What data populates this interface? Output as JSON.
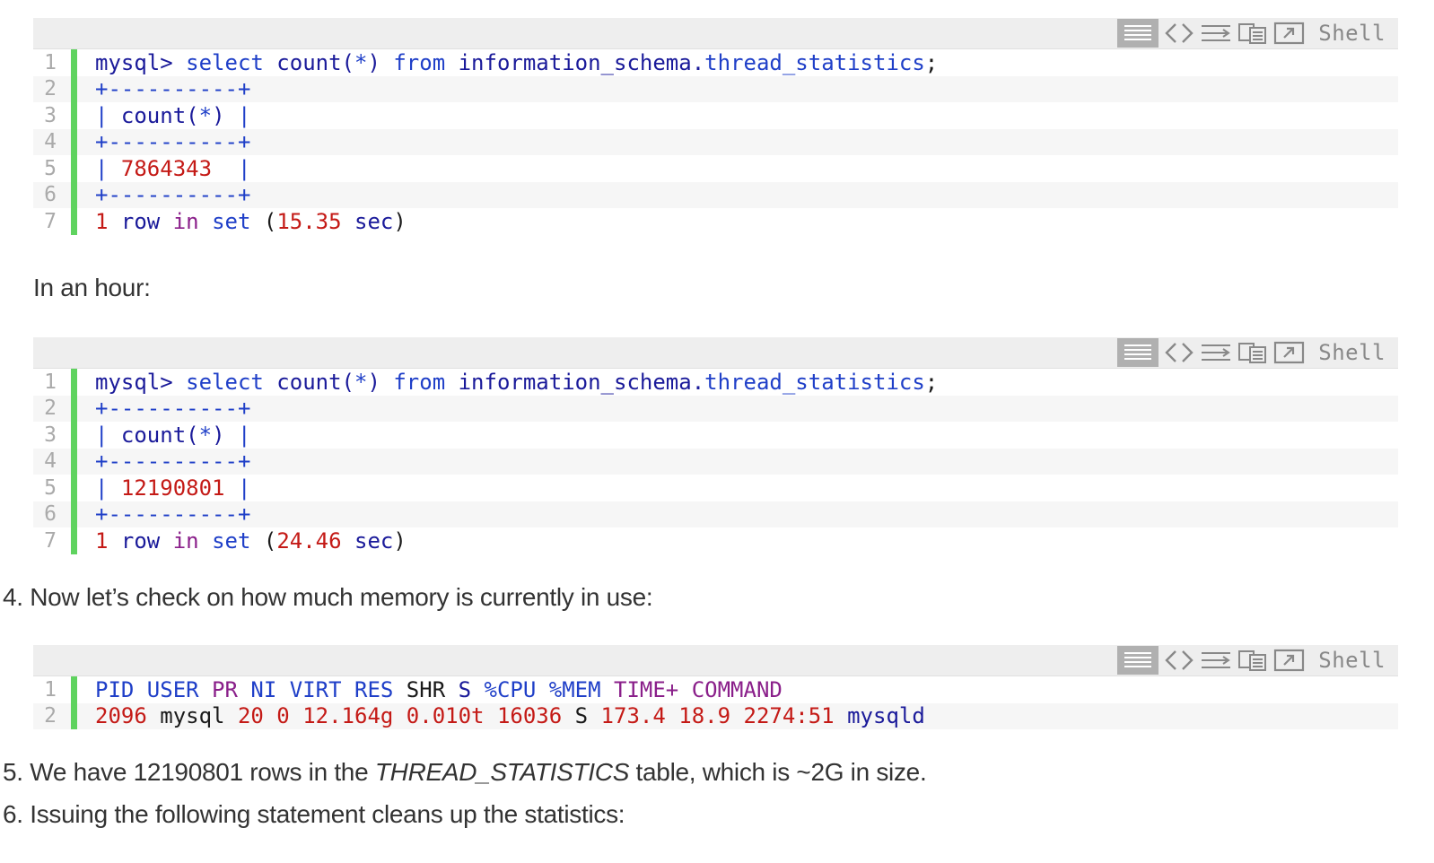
{
  "toolbar": {
    "lang_label": "Shell",
    "icons": [
      "view-lines-icon",
      "code-brackets-icon",
      "wrap-lines-icon",
      "copy-icon",
      "popout-icon"
    ]
  },
  "block1": {
    "lines": [
      {
        "n": "1",
        "tokens": [
          [
            "mysql>",
            "c-n"
          ],
          [
            " select ",
            "c-b"
          ],
          [
            "count(",
            "c-n"
          ],
          [
            "*",
            "c-b"
          ],
          [
            ") ",
            "c-n"
          ],
          [
            "from ",
            "c-b"
          ],
          [
            "information_schema.",
            "c-n"
          ],
          [
            "thread_statistics",
            "c-b"
          ],
          [
            ";",
            "c-k"
          ]
        ]
      },
      {
        "n": "2",
        "tokens": [
          [
            "+----------+",
            "c-b"
          ]
        ]
      },
      {
        "n": "3",
        "tokens": [
          [
            "| ",
            "c-b"
          ],
          [
            "count(",
            "c-n"
          ],
          [
            "*",
            "c-b"
          ],
          [
            ") ",
            "c-n"
          ],
          [
            "|",
            "c-b"
          ]
        ]
      },
      {
        "n": "4",
        "tokens": [
          [
            "+----------+",
            "c-b"
          ]
        ]
      },
      {
        "n": "5",
        "tokens": [
          [
            "| ",
            "c-b"
          ],
          [
            "7864343",
            "c-r"
          ],
          [
            "  |",
            "c-b"
          ]
        ]
      },
      {
        "n": "6",
        "tokens": [
          [
            "+----------+",
            "c-b"
          ]
        ]
      },
      {
        "n": "7",
        "tokens": [
          [
            "1",
            "c-r"
          ],
          [
            " row ",
            "c-n"
          ],
          [
            "in ",
            "c-p"
          ],
          [
            "set",
            "c-b"
          ],
          [
            " (",
            "c-k"
          ],
          [
            "15.35",
            "c-r"
          ],
          [
            " sec",
            "c-n"
          ],
          [
            ")",
            "c-k"
          ]
        ]
      }
    ]
  },
  "para_hour": "In an hour:",
  "block2": {
    "lines": [
      {
        "n": "1",
        "tokens": [
          [
            "mysql>",
            "c-n"
          ],
          [
            " select ",
            "c-b"
          ],
          [
            "count(",
            "c-n"
          ],
          [
            "*",
            "c-b"
          ],
          [
            ") ",
            "c-n"
          ],
          [
            "from ",
            "c-b"
          ],
          [
            "information_schema.",
            "c-n"
          ],
          [
            "thread_statistics",
            "c-b"
          ],
          [
            ";",
            "c-k"
          ]
        ]
      },
      {
        "n": "2",
        "tokens": [
          [
            "+----------+",
            "c-b"
          ]
        ]
      },
      {
        "n": "3",
        "tokens": [
          [
            "| ",
            "c-b"
          ],
          [
            "count(",
            "c-n"
          ],
          [
            "*",
            "c-b"
          ],
          [
            ") ",
            "c-n"
          ],
          [
            "|",
            "c-b"
          ]
        ]
      },
      {
        "n": "4",
        "tokens": [
          [
            "+----------+",
            "c-b"
          ]
        ]
      },
      {
        "n": "5",
        "tokens": [
          [
            "| ",
            "c-b"
          ],
          [
            "12190801",
            "c-r"
          ],
          [
            " |",
            "c-b"
          ]
        ]
      },
      {
        "n": "6",
        "tokens": [
          [
            "+----------+",
            "c-b"
          ]
        ]
      },
      {
        "n": "7",
        "tokens": [
          [
            "1",
            "c-r"
          ],
          [
            " row ",
            "c-n"
          ],
          [
            "in ",
            "c-p"
          ],
          [
            "set",
            "c-b"
          ],
          [
            " (",
            "c-k"
          ],
          [
            "24.46",
            "c-r"
          ],
          [
            " sec",
            "c-n"
          ],
          [
            ")",
            "c-k"
          ]
        ]
      }
    ]
  },
  "step4": "4. Now let’s check on how much memory is currently in use:",
  "block3": {
    "lines": [
      {
        "n": "1",
        "tokens": [
          [
            "PID USER ",
            "c-b"
          ],
          [
            "PR ",
            "c-p"
          ],
          [
            "NI VIRT RES ",
            "c-b"
          ],
          [
            "SHR ",
            "c-k"
          ],
          [
            "S ",
            "c-n"
          ],
          [
            "%CPU %MEM ",
            "c-b"
          ],
          [
            "TIME+ COMMAND",
            "c-p"
          ]
        ]
      },
      {
        "n": "2",
        "tokens": [
          [
            "2096",
            "c-r"
          ],
          [
            " mysql ",
            "c-k"
          ],
          [
            "20 0 12.164g 0.010t 16036",
            "c-r"
          ],
          [
            " S ",
            "c-k"
          ],
          [
            "173.4 18.9 2274:51",
            "c-r"
          ],
          [
            " mysqld",
            "c-n"
          ]
        ]
      }
    ]
  },
  "step5": {
    "pre": "5. We have 12190801 rows in the ",
    "em": "THREAD_STATISTICS",
    "post": " table, which is ~2G in size."
  },
  "step6": "6. Issuing the following statement cleans up the statistics:"
}
